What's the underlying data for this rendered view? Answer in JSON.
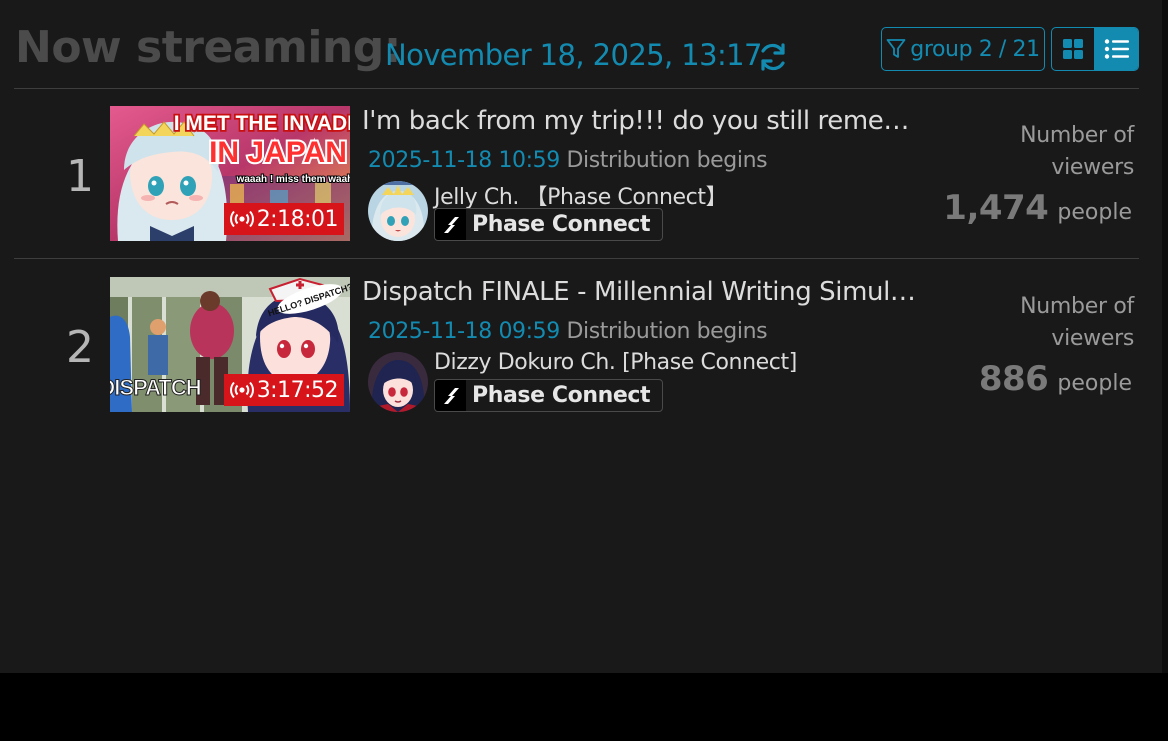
{
  "header": {
    "title": "Now streaming:",
    "timestamp": "November 18, 2025, 13:17",
    "group_filter": "group 2 / 21",
    "accent_color": "#138bb1",
    "icons": [
      "refresh-icon",
      "filter-icon",
      "grid-view-icon",
      "list-view-icon"
    ],
    "active_view": "list"
  },
  "streams": [
    {
      "rank": "1",
      "title": "I'm back from my trip!!! do you still rememb…",
      "thumbnail_text": {
        "line1": "I MET THE INVADERS",
        "line2": "IN JAPAN",
        "line3": "waaah ! miss them waahh"
      },
      "duration": "2:18:01",
      "start_time": "2025-11-18 10:59",
      "start_label": "Distribution begins",
      "channel": "Jelly Ch. 【Phase Connect】",
      "organization": "Phase Connect",
      "viewers_label": "Number of viewers",
      "viewers": "1,474",
      "viewers_unit": "people"
    },
    {
      "rank": "2",
      "title": "Dispatch FINALE - Millennial Writing Simulator…",
      "thumbnail_text": {
        "bubble": "HELLO? DISPATCH?",
        "logo": "DISPATCH"
      },
      "duration": "3:17:52",
      "start_time": "2025-11-18 09:59",
      "start_label": "Distribution begins",
      "channel": "Dizzy Dokuro Ch. [Phase Connect]",
      "organization": "Phase Connect",
      "viewers_label": "Number of viewers",
      "viewers": "886",
      "viewers_unit": "people"
    }
  ]
}
